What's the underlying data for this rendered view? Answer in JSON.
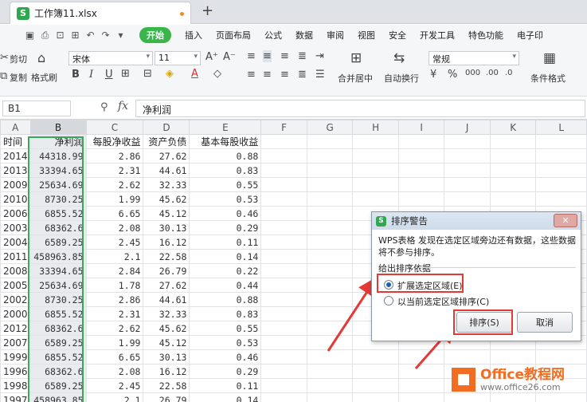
{
  "tab": {
    "icon_letter": "S",
    "title": "工作簿11.xlsx",
    "new_tab": "+"
  },
  "menu": {
    "start": "开始",
    "items": [
      "插入",
      "页面布局",
      "公式",
      "数据",
      "审阅",
      "视图",
      "安全",
      "开发工具",
      "特色功能",
      "电子印"
    ]
  },
  "ribbon": {
    "cut": "剪切",
    "copy": "复制",
    "format_painter": "格式刷",
    "font_name": "宋体",
    "font_size": "11",
    "merge_center": "合并居中",
    "wrap_text": "自动换行",
    "number_format": "常规",
    "conditional_format": "条件格式"
  },
  "formula_bar": {
    "name_box": "B1",
    "fx": "fx",
    "value": "净利润"
  },
  "sheet": {
    "columns": [
      "A",
      "B",
      "C",
      "D",
      "E",
      "F",
      "G",
      "H",
      "I",
      "J",
      "K",
      "L"
    ],
    "selected_column": "B",
    "header_row": [
      "时间",
      "净利润",
      "每股净收益",
      "资产负债",
      "基本每股收益"
    ],
    "rows": [
      [
        "2014",
        "44318.99",
        "2.86",
        "27.62",
        "0.88"
      ],
      [
        "2013",
        "33394.65",
        "2.31",
        "44.61",
        "0.83"
      ],
      [
        "2009",
        "25634.69",
        "2.62",
        "32.33",
        "0.55"
      ],
      [
        "2010",
        "8730.25",
        "1.99",
        "45.62",
        "0.53"
      ],
      [
        "2006",
        "6855.52",
        "6.65",
        "45.12",
        "0.46"
      ],
      [
        "2003",
        "68362.6",
        "2.08",
        "30.13",
        "0.29"
      ],
      [
        "2004",
        "6589.25",
        "2.45",
        "16.12",
        "0.11"
      ],
      [
        "2011",
        "458963.85",
        "2.1",
        "22.58",
        "0.14"
      ],
      [
        "2008",
        "33394.65",
        "2.84",
        "26.79",
        "0.22"
      ],
      [
        "2005",
        "25634.69",
        "1.78",
        "27.62",
        "0.44"
      ],
      [
        "2002",
        "8730.25",
        "2.86",
        "44.61",
        "0.88"
      ],
      [
        "2000",
        "6855.52",
        "2.31",
        "32.33",
        "0.83"
      ],
      [
        "2012",
        "68362.6",
        "2.62",
        "45.62",
        "0.55"
      ],
      [
        "2007",
        "6589.25",
        "1.99",
        "45.12",
        "0.53"
      ],
      [
        "1999",
        "6855.52",
        "6.65",
        "30.13",
        "0.46"
      ],
      [
        "1996",
        "68362.6",
        "2.08",
        "16.12",
        "0.29"
      ],
      [
        "1998",
        "6589.25",
        "2.45",
        "22.58",
        "0.11"
      ],
      [
        "1997",
        "458963.85",
        "2.1",
        "26.79",
        "0.14"
      ]
    ]
  },
  "dialog": {
    "title": "排序警告",
    "message": "WPS表格 发现在选定区域旁边还有数据，这些数据将不参与排序。",
    "section_label": "给出排序依据",
    "option_expand": "扩展选定区域(E)",
    "option_current": "以当前选定区域排序(C)",
    "selected_option": "expand",
    "sort_button": "排序(S)",
    "cancel_button": "取消",
    "close_glyph": "✕"
  },
  "watermark": {
    "title": "Office教程网",
    "url": "www.office26.com"
  },
  "colors": {
    "accent_green": "#39b54a",
    "highlight_red": "#e53935",
    "brand_orange": "#f26d21"
  }
}
